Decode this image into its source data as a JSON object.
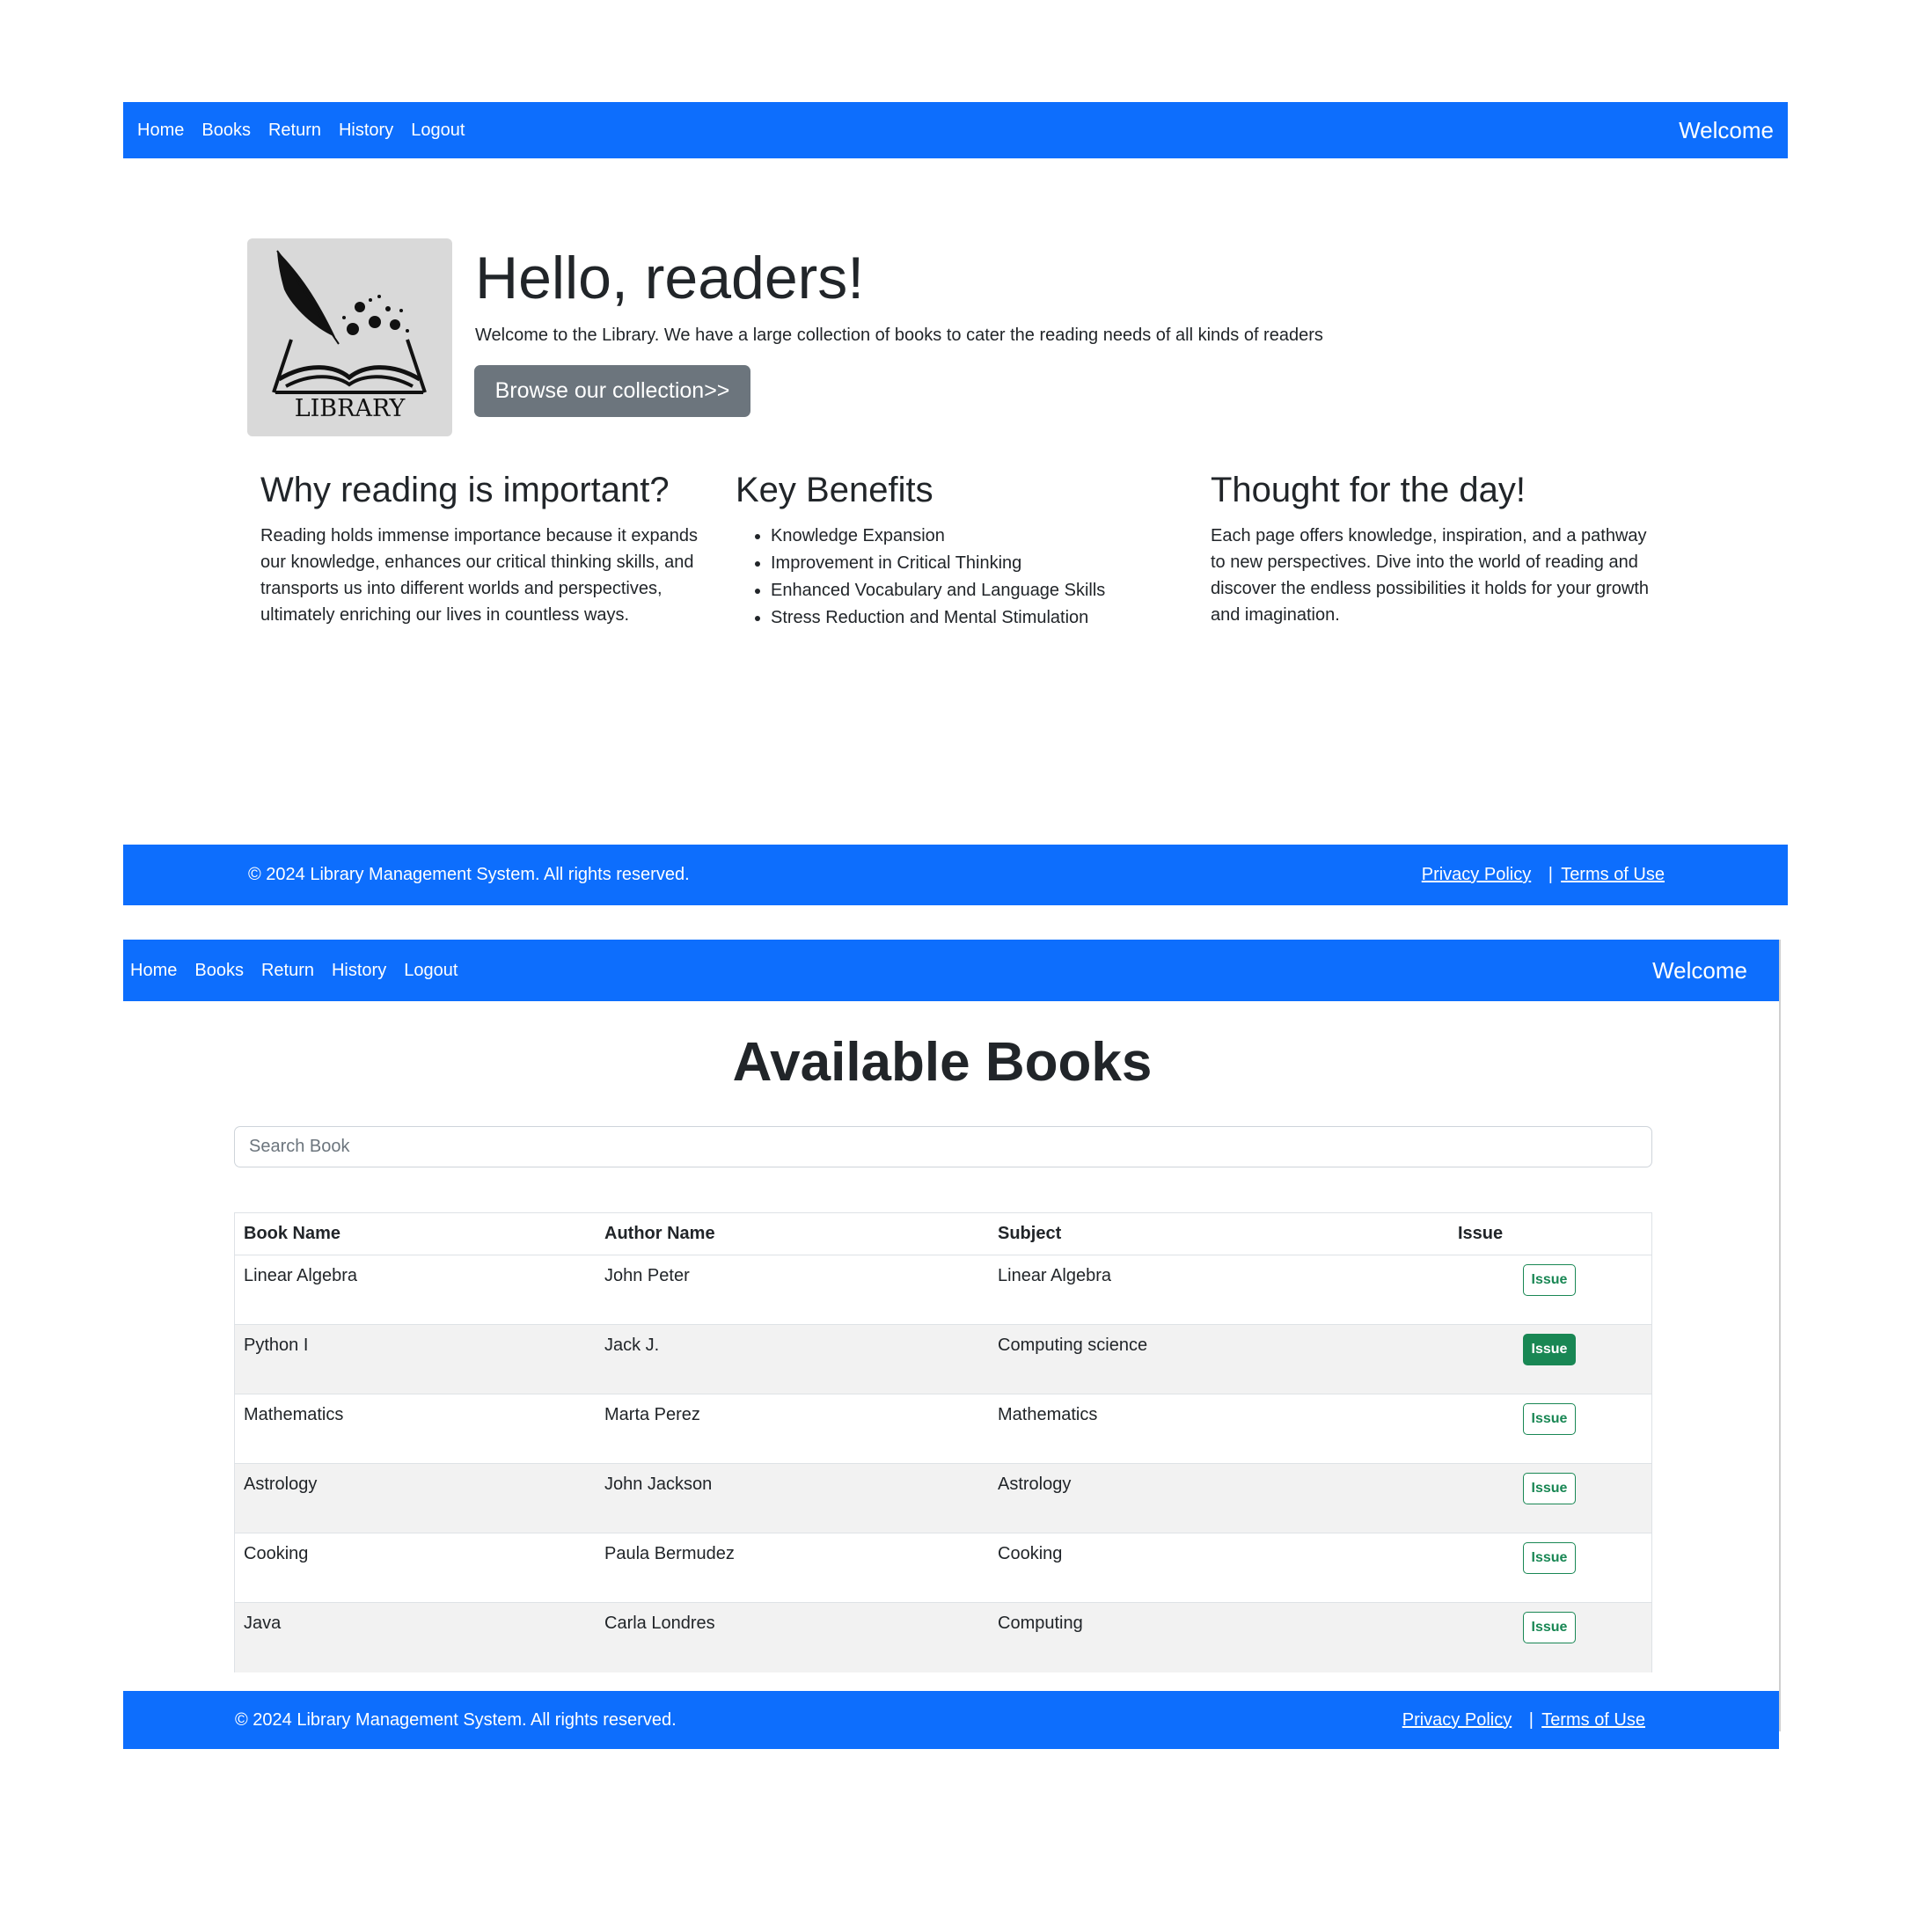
{
  "nav": {
    "items": [
      "Home",
      "Books",
      "Return",
      "History",
      "Logout"
    ],
    "welcome": "Welcome"
  },
  "hero": {
    "logo_text": "LIBRARY",
    "title": "Hello, readers!",
    "text": "Welcome to the Library. We have a large collection of books to cater the reading needs of all kinds of readers",
    "button": "Browse our collection>>"
  },
  "why": {
    "title": "Why reading is important?",
    "text": "Reading holds immense importance because it expands our knowledge, enhances our critical thinking skills, and transports us into different worlds and perspectives, ultimately enriching our lives in countless ways."
  },
  "benefits": {
    "title": "Key Benefits",
    "items": [
      "Knowledge Expansion",
      "Improvement in Critical Thinking",
      "Enhanced Vocabulary and Language Skills",
      "Stress Reduction and Mental Stimulation"
    ]
  },
  "thought": {
    "title": "Thought for the day!",
    "text": "Each page offers knowledge, inspiration, and a pathway to new perspectives. Dive into the world of reading and discover the endless possibilities it holds for your growth and imagination."
  },
  "footer": {
    "copyright": "© 2024 Library Management System. All rights reserved.",
    "privacy": "Privacy Policy",
    "separator": "|",
    "terms": "Terms of Use"
  },
  "books": {
    "title": "Available Books",
    "search_placeholder": "Search Book",
    "columns": [
      "Book Name",
      "Author Name",
      "Subject",
      "Issue"
    ],
    "rows": [
      {
        "name": "Linear Algebra",
        "author": "John Peter",
        "subject": "Linear Algebra",
        "action": "Issue"
      },
      {
        "name": "Python I",
        "author": "Jack J.",
        "subject": "Computing science",
        "action": "Issue"
      },
      {
        "name": "Mathematics",
        "author": "Marta Perez",
        "subject": "Mathematics",
        "action": "Issue"
      },
      {
        "name": "Astrology",
        "author": "John Jackson",
        "subject": "Astrology",
        "action": "Issue"
      },
      {
        "name": "Cooking",
        "author": "Paula Bermudez",
        "subject": "Cooking",
        "action": "Issue"
      },
      {
        "name": "Java",
        "author": "Carla Londres",
        "subject": "Computing",
        "action": "Issue"
      }
    ]
  },
  "colors": {
    "primary": "#0d6efd",
    "secondary": "#6c757d",
    "success": "#198754"
  }
}
